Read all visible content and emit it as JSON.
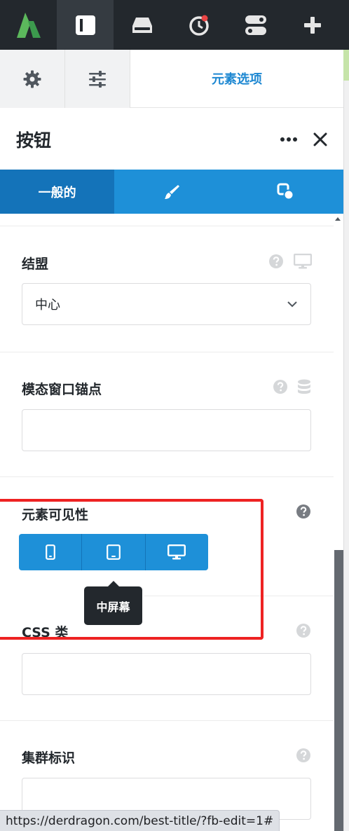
{
  "toolbar": {
    "items": [
      {
        "icon": "brand-logo-icon"
      },
      {
        "icon": "panel-icon",
        "active": true
      },
      {
        "icon": "drive-icon"
      },
      {
        "icon": "history-icon",
        "has_badge": true
      },
      {
        "icon": "toggle-icon"
      },
      {
        "icon": "plus-icon"
      }
    ],
    "badge_color": "#e94545"
  },
  "settings_tabs": {
    "active_label": "元素选项"
  },
  "element": {
    "title": "按钮"
  },
  "tabs": {
    "general_label": "一般的"
  },
  "fields": {
    "alignment": {
      "label": "结盟",
      "value": "中心"
    },
    "modal_anchor": {
      "label": "模态窗口锚点",
      "value": ""
    },
    "visibility": {
      "label": "元素可见性",
      "tooltip": "中屏幕"
    },
    "css_class": {
      "label": "CSS 类",
      "value": ""
    },
    "cluster_id": {
      "label": "集群标识",
      "value": ""
    }
  },
  "status_bar": {
    "url": "https://derdragon.com/best-title/?fb-edit=1#"
  },
  "colors": {
    "accent": "#1e90d8",
    "accent_dark": "#1473b9",
    "toolbar_bg": "#23282d",
    "highlight": "#ee2222"
  }
}
